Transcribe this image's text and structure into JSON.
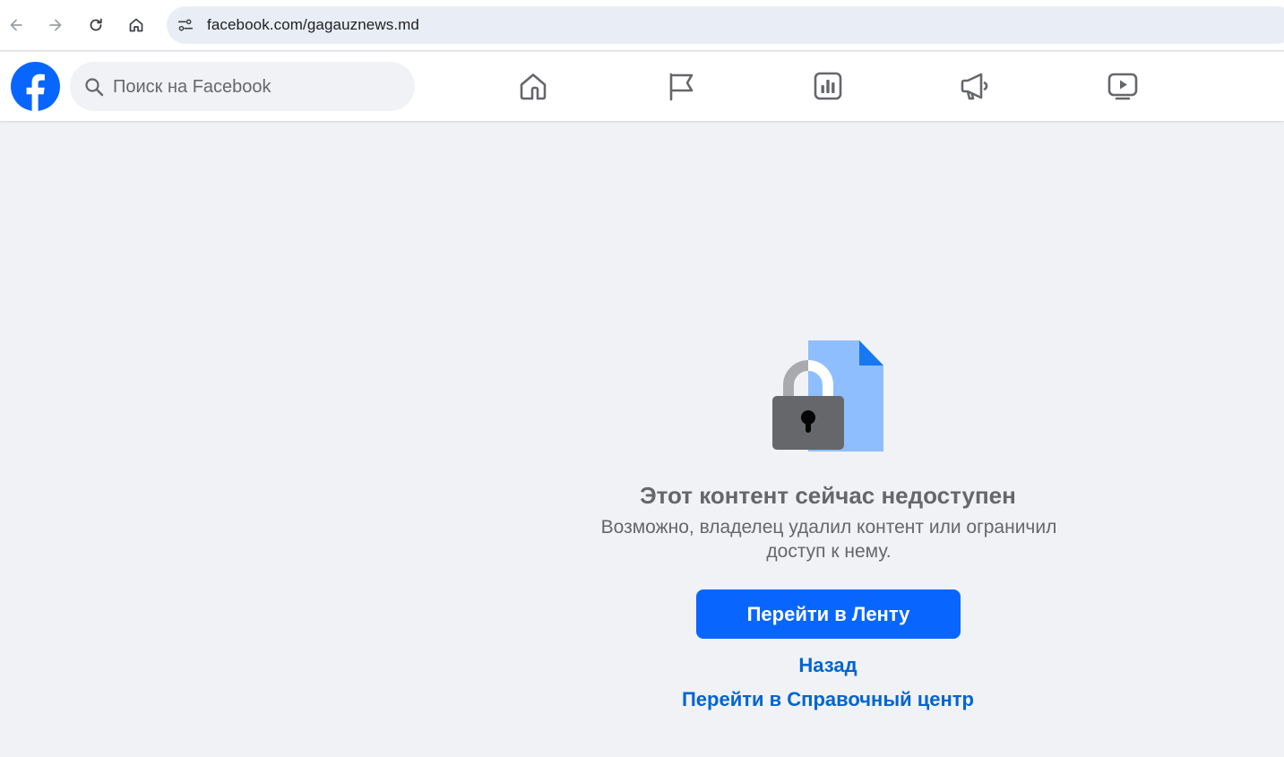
{
  "browser": {
    "url": "facebook.com/gagauznews.md"
  },
  "fb": {
    "search_placeholder": "Поиск на Facebook",
    "nav_icons": [
      "home-icon",
      "pages-flag-icon",
      "ads-manager-icon",
      "megaphone-icon",
      "video-icon"
    ]
  },
  "content": {
    "title": "Этот контент сейчас недоступен",
    "subtitle": "Возможно, владелец удалил контент или ограничил доступ к нему.",
    "primary_button": "Перейти в Ленту",
    "back_link": "Назад",
    "help_link": "Перейти в Справочный центр"
  },
  "colors": {
    "brand": "#0866ff",
    "link": "#0064d1",
    "muted_text": "#65676b",
    "page_bg": "#f0f2f5"
  }
}
